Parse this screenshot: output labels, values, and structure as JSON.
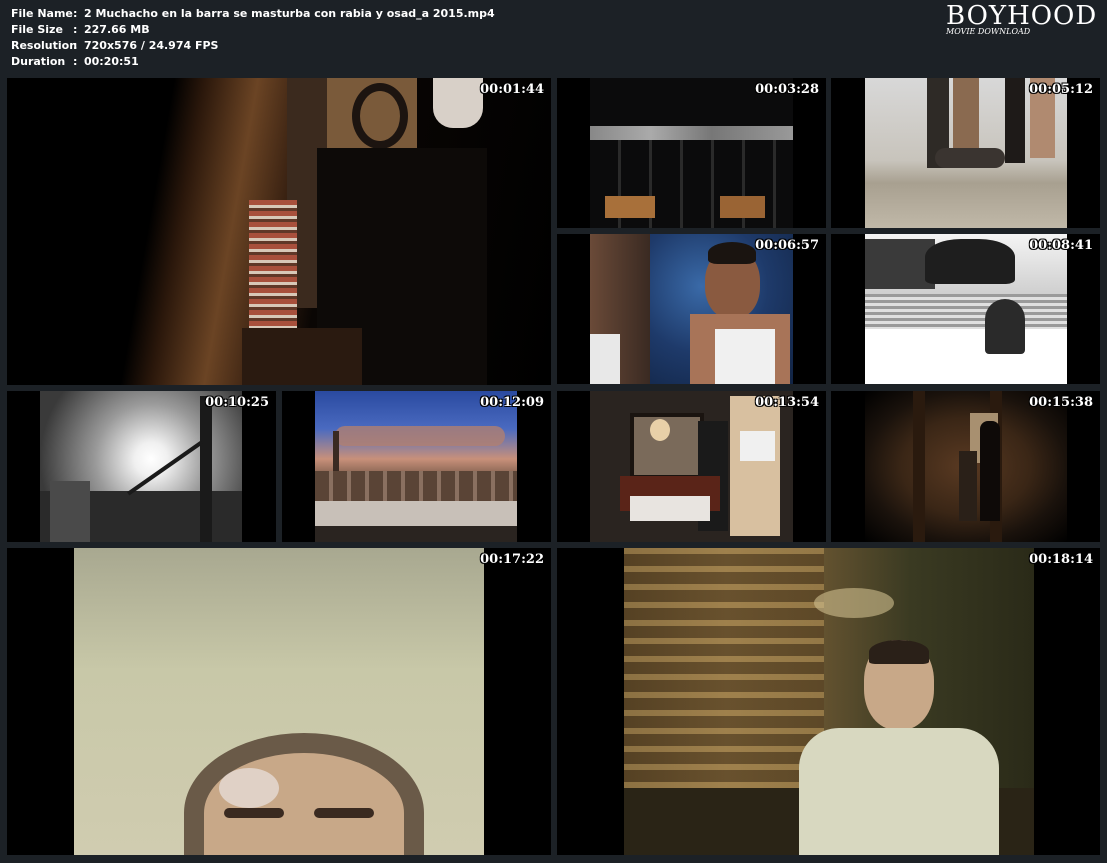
{
  "info": {
    "rows": [
      {
        "key": "File Name",
        "sep": ":",
        "value": "2 Muchacho en la barra se masturba con rabia y osad_a 2015.mp4"
      },
      {
        "key": "File Size",
        "sep": ":",
        "value": "227.66 MB"
      },
      {
        "key": "Resolution",
        "sep": ":",
        "value": "720x576 / 24.974 FPS"
      },
      {
        "key": "Duration",
        "sep": ":",
        "value": "00:20:51"
      }
    ]
  },
  "logo": {
    "title": "BOYHOOD",
    "subtitle": "MOVIE DOWNLOAD"
  },
  "thumbnails": [
    {
      "timestamp": "00:01:44"
    },
    {
      "timestamp": "00:03:28"
    },
    {
      "timestamp": "00:05:12"
    },
    {
      "timestamp": "00:06:57"
    },
    {
      "timestamp": "00:08:41"
    },
    {
      "timestamp": "00:10:25"
    },
    {
      "timestamp": "00:12:09"
    },
    {
      "timestamp": "00:13:54"
    },
    {
      "timestamp": "00:15:38"
    },
    {
      "timestamp": "00:17:22"
    },
    {
      "timestamp": "00:18:14"
    }
  ]
}
